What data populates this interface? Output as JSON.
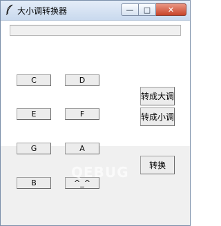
{
  "window": {
    "title": "大小调转换器",
    "min_glyph": "—",
    "max_glyph": "□",
    "close_glyph": "✕"
  },
  "entry": {
    "value": "",
    "placeholder": ""
  },
  "note_buttons": [
    "C",
    "D",
    "E",
    "F",
    "G",
    "A",
    "B",
    "^_^"
  ],
  "side_buttons": {
    "to_major": "转成大调",
    "to_minor": "转成小调",
    "convert": "转换"
  },
  "watermark": "QEBUG"
}
